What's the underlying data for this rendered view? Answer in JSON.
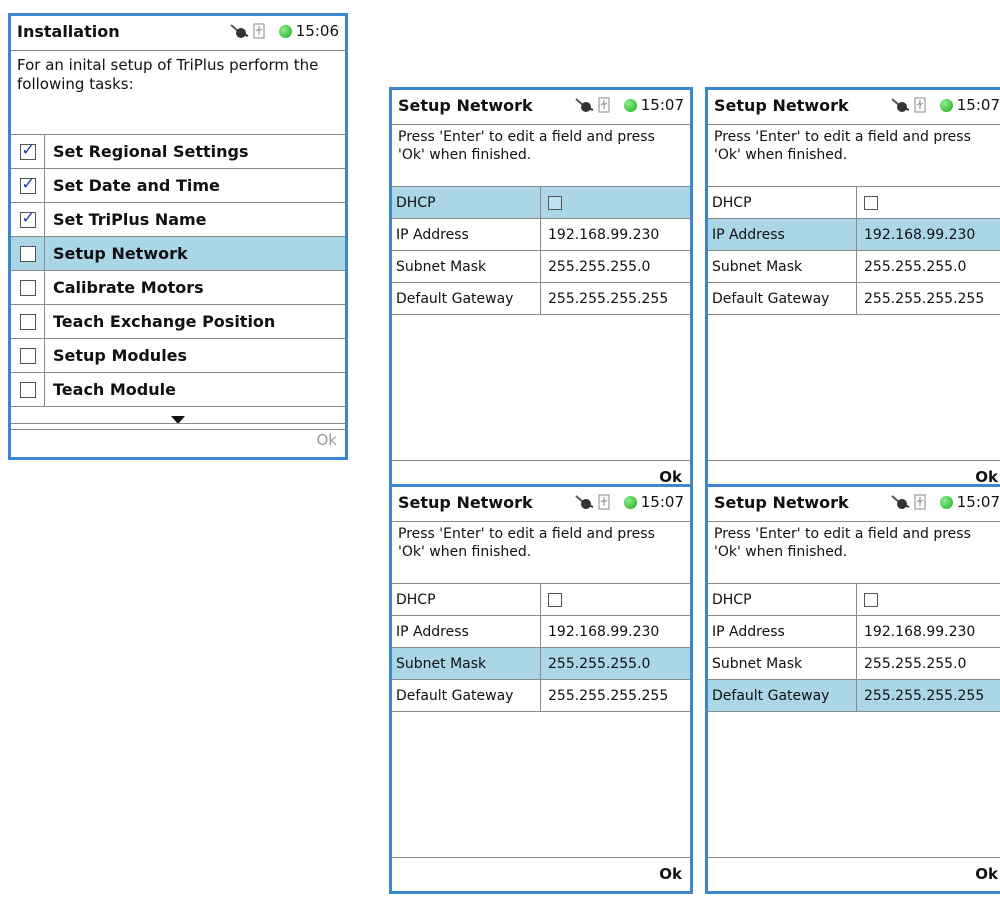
{
  "installation": {
    "title": "Installation",
    "time": "15:06",
    "description": "For an inital setup of TriPlus perform the following tasks:",
    "tasks": [
      {
        "label": "Set Regional Settings",
        "checked": true
      },
      {
        "label": "Set Date and Time",
        "checked": true
      },
      {
        "label": "Set TriPlus Name",
        "checked": true
      },
      {
        "label": "Setup Network",
        "checked": false
      },
      {
        "label": "Calibrate Motors",
        "checked": false
      },
      {
        "label": "Teach Exchange Position",
        "checked": false
      },
      {
        "label": "Setup Modules",
        "checked": false
      },
      {
        "label": "Teach Module",
        "checked": false
      }
    ],
    "ok_label": "Ok"
  },
  "network": {
    "title": "Setup Network",
    "time": "15:07",
    "description": "Press 'Enter' to edit a field and press 'Ok' when finished.",
    "fields": [
      {
        "name": "DHCP",
        "value": ""
      },
      {
        "name": "IP Address",
        "value": "192.168.99.230"
      },
      {
        "name": "Subnet Mask",
        "value": "255.255.255.0"
      },
      {
        "name": "Default Gateway",
        "value": "255.255.255.255"
      }
    ],
    "ok_label": "Ok"
  },
  "colors": {
    "frame": "#3a86cf",
    "selection": "#aad6e6",
    "status_dot": "#18a818"
  },
  "icons": [
    "plug-icon",
    "usb-icon",
    "status-dot-icon",
    "checkbox-icon",
    "down-arrow-icon"
  ]
}
